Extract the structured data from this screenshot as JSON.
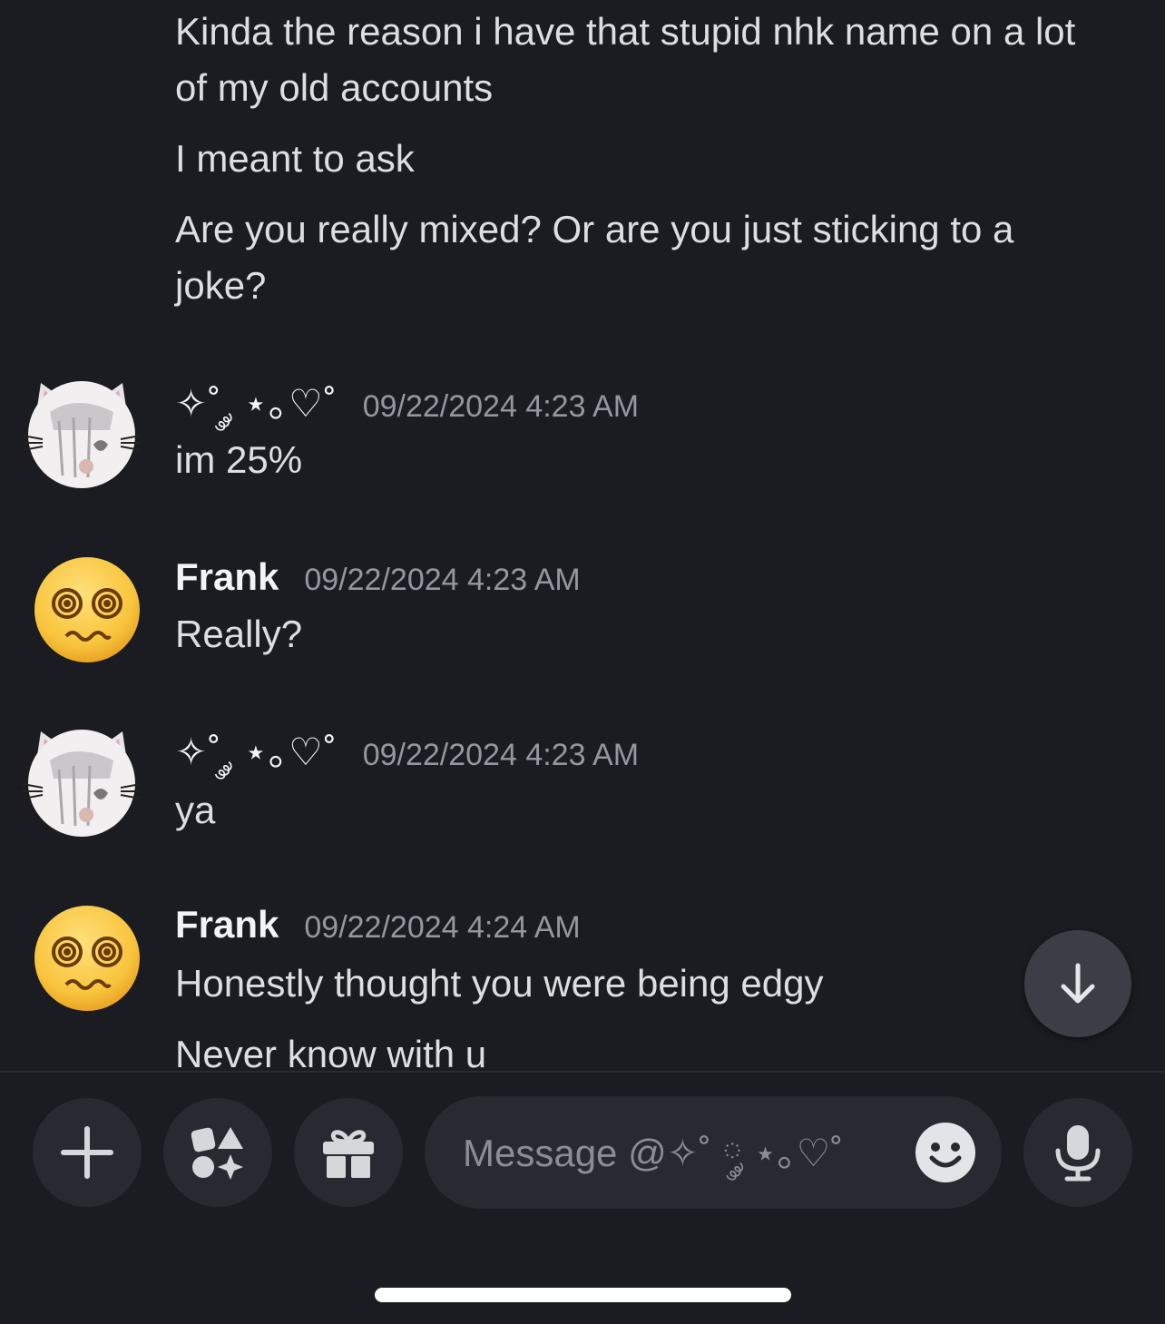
{
  "messages": {
    "top_lines": [
      "Kinda the reason i have that stupid nhk name on a lot of my old accounts",
      "I meant to ask",
      "Are you really mixed? Or are you just sticking to a joke?"
    ],
    "groups": [
      {
        "author": "✧˚ ༘ ⋆｡♡˚",
        "timestamp": "09/22/2024 4:23 AM",
        "lines": [
          "im 25%"
        ]
      },
      {
        "author": "Frank",
        "timestamp": "09/22/2024 4:23 AM",
        "lines": [
          "Really?"
        ]
      },
      {
        "author": "✧˚ ༘ ⋆｡♡˚",
        "timestamp": "09/22/2024 4:23 AM",
        "lines": [
          "ya"
        ]
      },
      {
        "author": "Frank",
        "timestamp": "09/22/2024 4:24 AM",
        "lines": [
          "Honestly thought you were being edgy",
          "Never know with u"
        ]
      }
    ]
  },
  "composer": {
    "placeholder": "Message @✧˚ ༘ ⋆｡♡˚"
  },
  "icons": {
    "add": "plus-icon",
    "apps": "apps-shapes-icon",
    "gift": "gift-icon",
    "emoji": "emoji-smile-icon",
    "mic": "microphone-icon",
    "jump": "arrow-down-icon"
  },
  "colors": {
    "background": "#1b1c21",
    "button": "#292a31",
    "text": "#dddee1",
    "timestamp": "#9597a0"
  }
}
